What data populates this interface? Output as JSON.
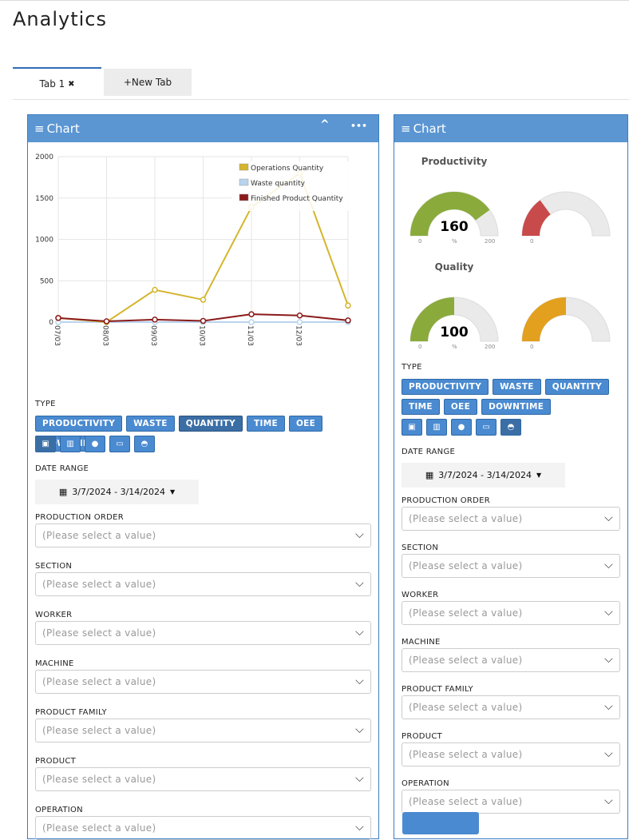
{
  "page_title": "Analytics",
  "tabs": [
    {
      "label": "Tab 1",
      "close_icon": "✖"
    },
    {
      "label": "+New Tab"
    }
  ],
  "panels": [
    {
      "title": "Chart",
      "menu_icon": "≡",
      "collapse_icon": "^",
      "more_icon": "•••"
    },
    {
      "title": "Chart",
      "menu_icon": "≡"
    }
  ],
  "chart_data": {
    "type": "line",
    "x": [
      "07/03",
      "08/03",
      "09/03",
      "10/03",
      "11/03",
      "12/03",
      ""
    ],
    "series": [
      {
        "name": "Operations Quantity",
        "color": "#d4b52c",
        "values": [
          50,
          0,
          390,
          270,
          1390,
          1800,
          200
        ]
      },
      {
        "name": "Waste quantity",
        "color": "#b8d4ee",
        "values": [
          0,
          0,
          0,
          0,
          0,
          0,
          0
        ]
      },
      {
        "name": "Finished Product Quantity",
        "color": "#8b1a1a",
        "values": [
          50,
          10,
          30,
          15,
          95,
          80,
          20
        ]
      }
    ],
    "ylim": [
      0,
      2000
    ],
    "yticks": [
      "0",
      "500",
      "1000",
      "1500",
      "2000"
    ],
    "grid": true,
    "legend": "top-right"
  },
  "controls": {
    "type_label": "TYPE",
    "type_buttons": [
      "PRODUCTIVITY",
      "WASTE",
      "QUANTITY",
      "TIME",
      "OEE",
      "DOWNTIME"
    ],
    "active_type_left": "QUANTITY",
    "view_icons": [
      "image-icon",
      "bar-chart-icon",
      "user-icon",
      "machine-icon",
      "gauge-icon"
    ],
    "date_range_label": "DATE RANGE",
    "date_range": "3/7/2024 - 3/14/2024",
    "placeholder": "(Please select a value)",
    "filters": [
      "PRODUCTION ORDER",
      "SECTION",
      "WORKER",
      "MACHINE",
      "PRODUCT FAMILY",
      "PRODUCT",
      "OPERATION"
    ]
  },
  "gauges": [
    {
      "title": "Productivity",
      "value": "160",
      "unit": "%",
      "min": "0",
      "max": "200",
      "fraction": 0.8,
      "color": "#8aab3c"
    },
    {
      "title": "Quality",
      "value": "100",
      "unit": "%",
      "min": "0",
      "max": "200",
      "fraction": 0.5,
      "color": "#8aab3c"
    },
    {
      "min": "0",
      "fraction": 0.3,
      "color": "#c94a4a"
    },
    {
      "min": "0",
      "fraction": 0.5,
      "color": "#e2a01e"
    }
  ]
}
